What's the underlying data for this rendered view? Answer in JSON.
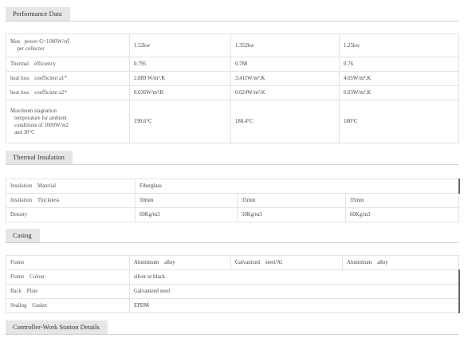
{
  "sections": {
    "performance": "Performance Data",
    "insulation": "Thermal Insulation",
    "casing": "Casing",
    "controller": "Controller-Work Station Details"
  },
  "performance": [
    {
      "label": "Max   power G=1000W/㎡\n     per collector",
      "values": [
        "1.52kw",
        "1.352kw",
        "1.25kw"
      ]
    },
    {
      "label": "Thermal    efficiency",
      "values": [
        "0.795",
        "0.788",
        "0.76"
      ]
    },
    {
      "label": "heat loss    coefficient a1*",
      "values": [
        "2.889 W/m².K",
        "3.411W/m².K",
        "4.05W/m².K"
      ]
    },
    {
      "label": "heat loss    coefficient a2*",
      "values": [
        "0.026W/m².K",
        "0.024W/m².K",
        "0.03W/m².K"
      ]
    },
    {
      "label": "Maximum stagnation\n   temperature for ambient\n   conditions of 1000W/m2\n   and 30°C",
      "values": [
        "190.6°C",
        "188.4°C",
        "180°C"
      ]
    }
  ],
  "insulation": [
    {
      "label": "Insulation    Material",
      "values": [
        "Fiberglass"
      ]
    },
    {
      "label": "Insulation    Thickness",
      "values": [
        "50mm",
        "35mm",
        "35mm"
      ]
    },
    {
      "label": "Density",
      "values": [
        "60Kg/m3",
        "50Kg/m3",
        "60Kg/m3"
      ]
    }
  ],
  "casing": [
    {
      "label": "Frame",
      "values": [
        "Aluminium    alloy",
        "Galvanized    steel/Al",
        "Aluminium    alloy"
      ]
    },
    {
      "label": "Frame    Colour",
      "values": [
        "silver or black"
      ]
    },
    {
      "label": "Back    Plate",
      "values": [
        "Galvanized steel"
      ]
    },
    {
      "label": "Sealing    Gasket",
      "values": [
        "EPDM"
      ]
    }
  ]
}
